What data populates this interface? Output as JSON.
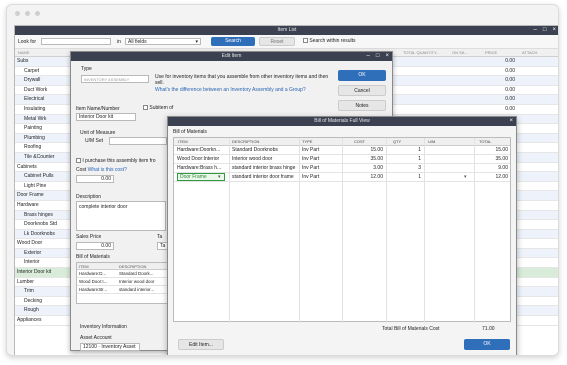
{
  "item_list": {
    "title": "Item List",
    "look_for_label": "Look for",
    "in_label": "in",
    "in_value": "All fields",
    "search_label": "Search",
    "reset_label": "Reset",
    "search_within_label": "Search within results",
    "columns": {
      "name": "NAME",
      "total_quantity": "TOTAL QUANTITY...",
      "on_sales": "ON SA...",
      "price": "PRICE",
      "attach": "ATTACH"
    },
    "rows": [
      {
        "name": "Subs",
        "price": "0.00",
        "indent": 0
      },
      {
        "name": "Carpet",
        "price": "0.00",
        "indent": 1
      },
      {
        "name": "Drywall",
        "price": "0.00",
        "indent": 1
      },
      {
        "name": "Duct Work",
        "price": "0.00",
        "indent": 1
      },
      {
        "name": "Electrical",
        "price": "0.00",
        "indent": 1
      },
      {
        "name": "Insulating",
        "price": "0.00",
        "indent": 1
      },
      {
        "name": "Metal Wrk",
        "price": "0.00",
        "indent": 1
      },
      {
        "name": "Painting",
        "price": "0.00",
        "indent": 1
      },
      {
        "name": "Plumbing",
        "price": "0.00",
        "indent": 1
      },
      {
        "name": "Roofing",
        "price": "0.00",
        "indent": 1
      },
      {
        "name": "Tile &Counter",
        "price": "0.00",
        "indent": 1
      },
      {
        "name": "Cabinets",
        "price": "0.00",
        "indent": 0
      },
      {
        "name": "Cabinet Pulls",
        "price": "0.00",
        "indent": 1
      },
      {
        "name": "Light Pine",
        "price": "0.00",
        "indent": 1
      },
      {
        "name": "Door Frame",
        "price": "0.00",
        "indent": 0
      },
      {
        "name": "Hardware",
        "price": "0.00",
        "indent": 0
      },
      {
        "name": "Brass hinges",
        "price": "0.00",
        "indent": 1
      },
      {
        "name": "Doorknobs Std",
        "price": "0.00",
        "indent": 1
      },
      {
        "name": "Lk Doorknobs",
        "price": "0.00",
        "indent": 1
      },
      {
        "name": "Wood Door",
        "price": "0.00",
        "indent": 0
      },
      {
        "name": "Exterior",
        "price": "0.00",
        "indent": 1
      },
      {
        "name": "Interior",
        "price": "0.00",
        "indent": 1
      },
      {
        "name": "Interior Door kit",
        "price": "0.00",
        "indent": 0
      },
      {
        "name": "Lumber",
        "price": "0.00",
        "indent": 0
      },
      {
        "name": "Trim",
        "price": "0.00",
        "indent": 1
      },
      {
        "name": "Decking",
        "price": "0.00",
        "indent": 1
      },
      {
        "name": "Rough",
        "price": "0.00",
        "indent": 1
      },
      {
        "name": "Appliances",
        "price": "0.00",
        "indent": 0
      }
    ]
  },
  "edit_item": {
    "title": "Edit Item",
    "type_label": "Type",
    "type_value": "INVENTORY ASSEMBLY",
    "type_help": "Use for inventory items that you assemble from other inventory items and then sell.",
    "type_link": "What's the difference between an Inventory Assembly and a Group?",
    "ok_label": "OK",
    "cancel_label": "Cancel",
    "notes_label": "Notes",
    "item_name_label": "Item Name/Number",
    "item_name_value": "Interior Door kit",
    "subitem_label": "Subitem of",
    "uom_label": "Unit of Measure",
    "uom_set_label": "U/M Set",
    "purchase_label": "I purchase this assembly item fro",
    "cost_label": "Cost",
    "cost_link": "What is this cost?",
    "cost_value": "0.00",
    "description_label": "Description",
    "description_value": "complete interior door",
    "sales_price_label": "Sales Price",
    "sales_price_value": "0.00",
    "tax_label": "Ta",
    "tax_value": "Ta",
    "bom_label": "Bill of Materials",
    "bom_columns": {
      "item": "ITEM",
      "description": "DESCRIPTION"
    },
    "bom_rows": [
      {
        "item": "Hardware:D...",
        "description": "Standard Doork..."
      },
      {
        "item": "Wood Door:I...",
        "description": "Interior wood door"
      },
      {
        "item": "Hardware:Br...",
        "description": "standard interior..."
      }
    ],
    "inventory_info_label": "Inventory Information",
    "asset_account_label": "Asset Account",
    "asset_account_value": "12100 · Inventory Asset"
  },
  "bom_full_view": {
    "title": "Bill of Materials Full View",
    "section_label": "Bill of Materials",
    "columns": {
      "item": "ITEM",
      "description": "DESCRIPTION",
      "type": "TYPE",
      "cost": "COST",
      "qty": "QTY",
      "um": "U/M",
      "total": "TOTAL"
    },
    "rows": [
      {
        "item": "Hardware:Doorkn...",
        "description": "Standard Doorknobs",
        "type": "Inv Part",
        "cost": "15.00",
        "qty": "1",
        "um": "",
        "total": "15.00"
      },
      {
        "item": "Wood Door:Interior",
        "description": "Interior wood door",
        "type": "Inv Part",
        "cost": "35.00",
        "qty": "1",
        "um": "",
        "total": "35.00"
      },
      {
        "item": "Hardware:Brass h...",
        "description": "standard interior brass hinge",
        "type": "Inv Part",
        "cost": "3.00",
        "qty": "3",
        "um": "",
        "total": "9.00"
      },
      {
        "item": "Door Frame",
        "description": "standard interior door frame",
        "type": "Inv Part",
        "cost": "12.00",
        "qty": "1",
        "um": "",
        "total": "12.00"
      }
    ],
    "total_label": "Total Bill of Materials Cost",
    "total_value": "71.00",
    "edit_item_label": "Edit Item...",
    "ok_label": "OK"
  },
  "colors": {
    "title_bar": "#3b4151",
    "accent": "#2f6fba",
    "selected_row": "#d9ecd9"
  }
}
